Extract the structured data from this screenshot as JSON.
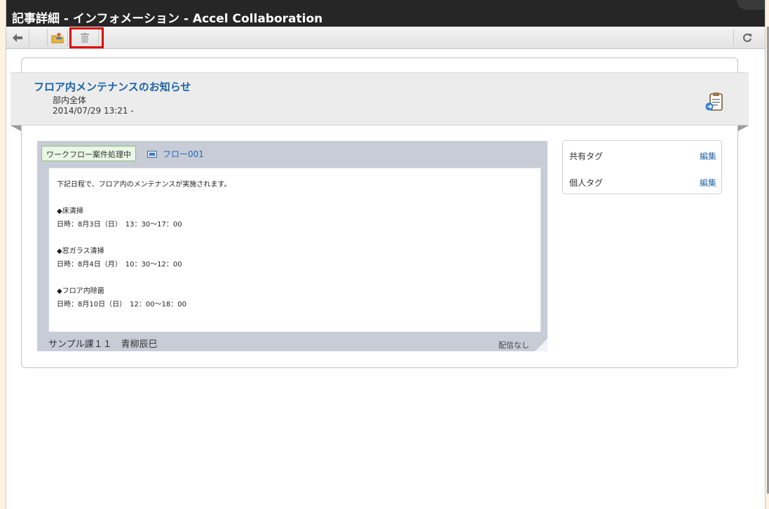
{
  "window": {
    "title": "記事詳細 - インフォメーション - Accel Collaboration"
  },
  "toolbar": {
    "back_icon": "arrow-left-icon",
    "edit_icon": "folder-user-icon",
    "delete_icon": "trash-icon",
    "refresh_icon": "refresh-icon",
    "highlight_color": "#e00000"
  },
  "article": {
    "title": "フロア内メンテナンスのお知らせ",
    "group": "部内全体",
    "date": "2014/07/29 13:21 -",
    "title_color": "#1d63a4",
    "action_icon": "clipboard-icon"
  },
  "workflow": {
    "status": "ワークフロー案件処理中",
    "flow_link": "フロー001"
  },
  "body": {
    "lines": [
      "下記日程で、フロア内のメンテナンスが実施されます。",
      "",
      "◆床清掃",
      "日時：8月3日（日）　13：30～17：00",
      "",
      "◆窓ガラス清掃",
      "日時：8月4日（月）　10：30～12：00",
      "",
      "◆フロア内除菌",
      "日時：8月10日（日）　12：00～18：00"
    ],
    "author": "サンプル課１１　青柳辰巳",
    "delivery": "配信なし"
  },
  "tags": {
    "shared_label": "共有タグ",
    "shared_edit": "編集",
    "personal_label": "個人タグ",
    "personal_edit": "編集"
  }
}
